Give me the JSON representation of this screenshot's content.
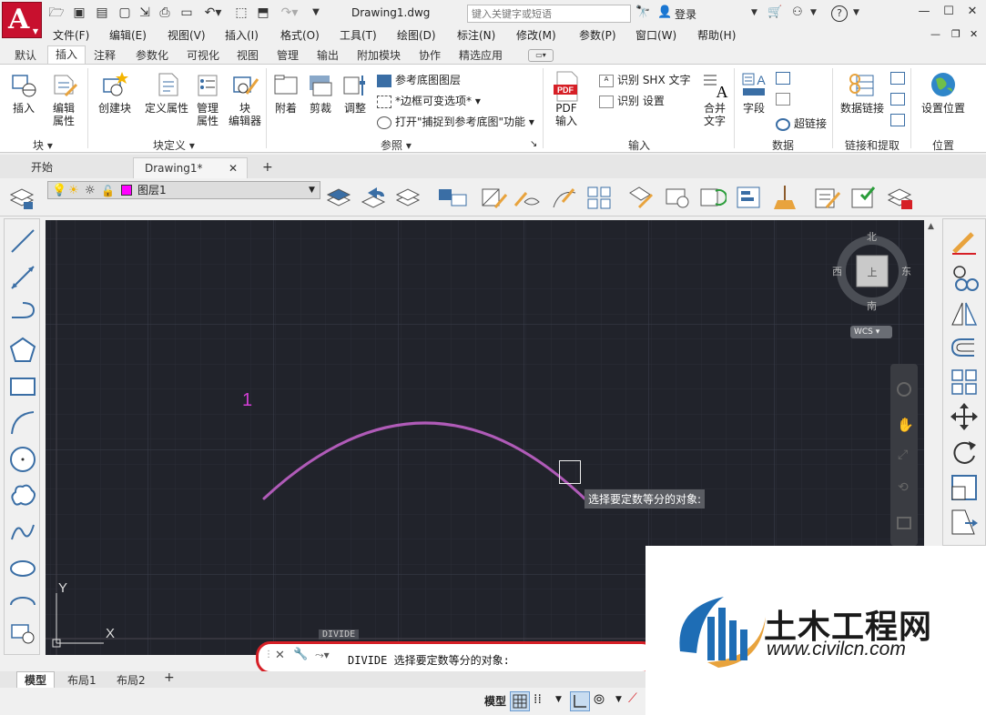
{
  "app": {
    "title": "Drawing1.dwg",
    "logo_letter": "A"
  },
  "search": {
    "placeholder": "键入关键字或短语"
  },
  "account": {
    "login_label": "登录"
  },
  "menu": [
    "文件(F)",
    "编辑(E)",
    "视图(V)",
    "插入(I)",
    "格式(O)",
    "工具(T)",
    "绘图(D)",
    "标注(N)",
    "修改(M)",
    "参数(P)",
    "窗口(W)",
    "帮助(H)"
  ],
  "ribbon_tabs": [
    "默认",
    "插入",
    "注释",
    "参数化",
    "可视化",
    "视图",
    "管理",
    "输出",
    "附加模块",
    "协作",
    "精选应用"
  ],
  "active_ribbon_tab": "插入",
  "ribbon": {
    "block": {
      "insert": "插入",
      "edit_attr_1": "编辑",
      "edit_attr_2": "属性",
      "panel": "块 ▾"
    },
    "block_def": {
      "create": "创建块",
      "define_attr": "定义属性",
      "manage_1": "管理",
      "manage_2": "属性",
      "editor_1": "块",
      "editor_2": "编辑器",
      "panel": "块定义 ▾"
    },
    "reference": {
      "attach": "附着",
      "clip": "剪裁",
      "adjust": "调整",
      "underlay_layers": "参考底图图层",
      "frame": "*边框可变选项*",
      "snap": "打开\"捕捉到参考底图\"功能",
      "panel": "参照 ▾"
    },
    "import": {
      "pdf_badge": "PDF",
      "pdf_1": "PDF",
      "pdf_2": "输入",
      "shx": "识别 SHX 文字",
      "settings": "识别 设置",
      "merge_1": "合并",
      "merge_2": "文字",
      "panel": "输入"
    },
    "data": {
      "field": "字段",
      "hyperlink": "超链接",
      "panel": "数据"
    },
    "link": {
      "data_link": "数据链接",
      "panel": "链接和提取"
    },
    "location": {
      "set": "设置位置",
      "panel": "位置"
    }
  },
  "doc_tabs": [
    "开始",
    "Drawing1*"
  ],
  "layer": {
    "name": "图层1",
    "color": "#ff00ff"
  },
  "viewcube": {
    "north": "北",
    "south": "南",
    "east": "东",
    "west": "西",
    "wcs": "WCS"
  },
  "canvas": {
    "label_number": "1",
    "arc_color": "#b05bb8",
    "ucs_y": "Y",
    "ucs_x": "X",
    "tooltip": "选择要定数等分的对象:",
    "cmd_echo": "DIVIDE"
  },
  "command": {
    "text": "DIVIDE 选择要定数等分的对象:"
  },
  "layout_tabs": [
    "模型",
    "布局1",
    "布局2"
  ],
  "status": {
    "model": "模型"
  },
  "watermark": {
    "brand": "土木工程网",
    "url": "www.civilcn.com"
  }
}
